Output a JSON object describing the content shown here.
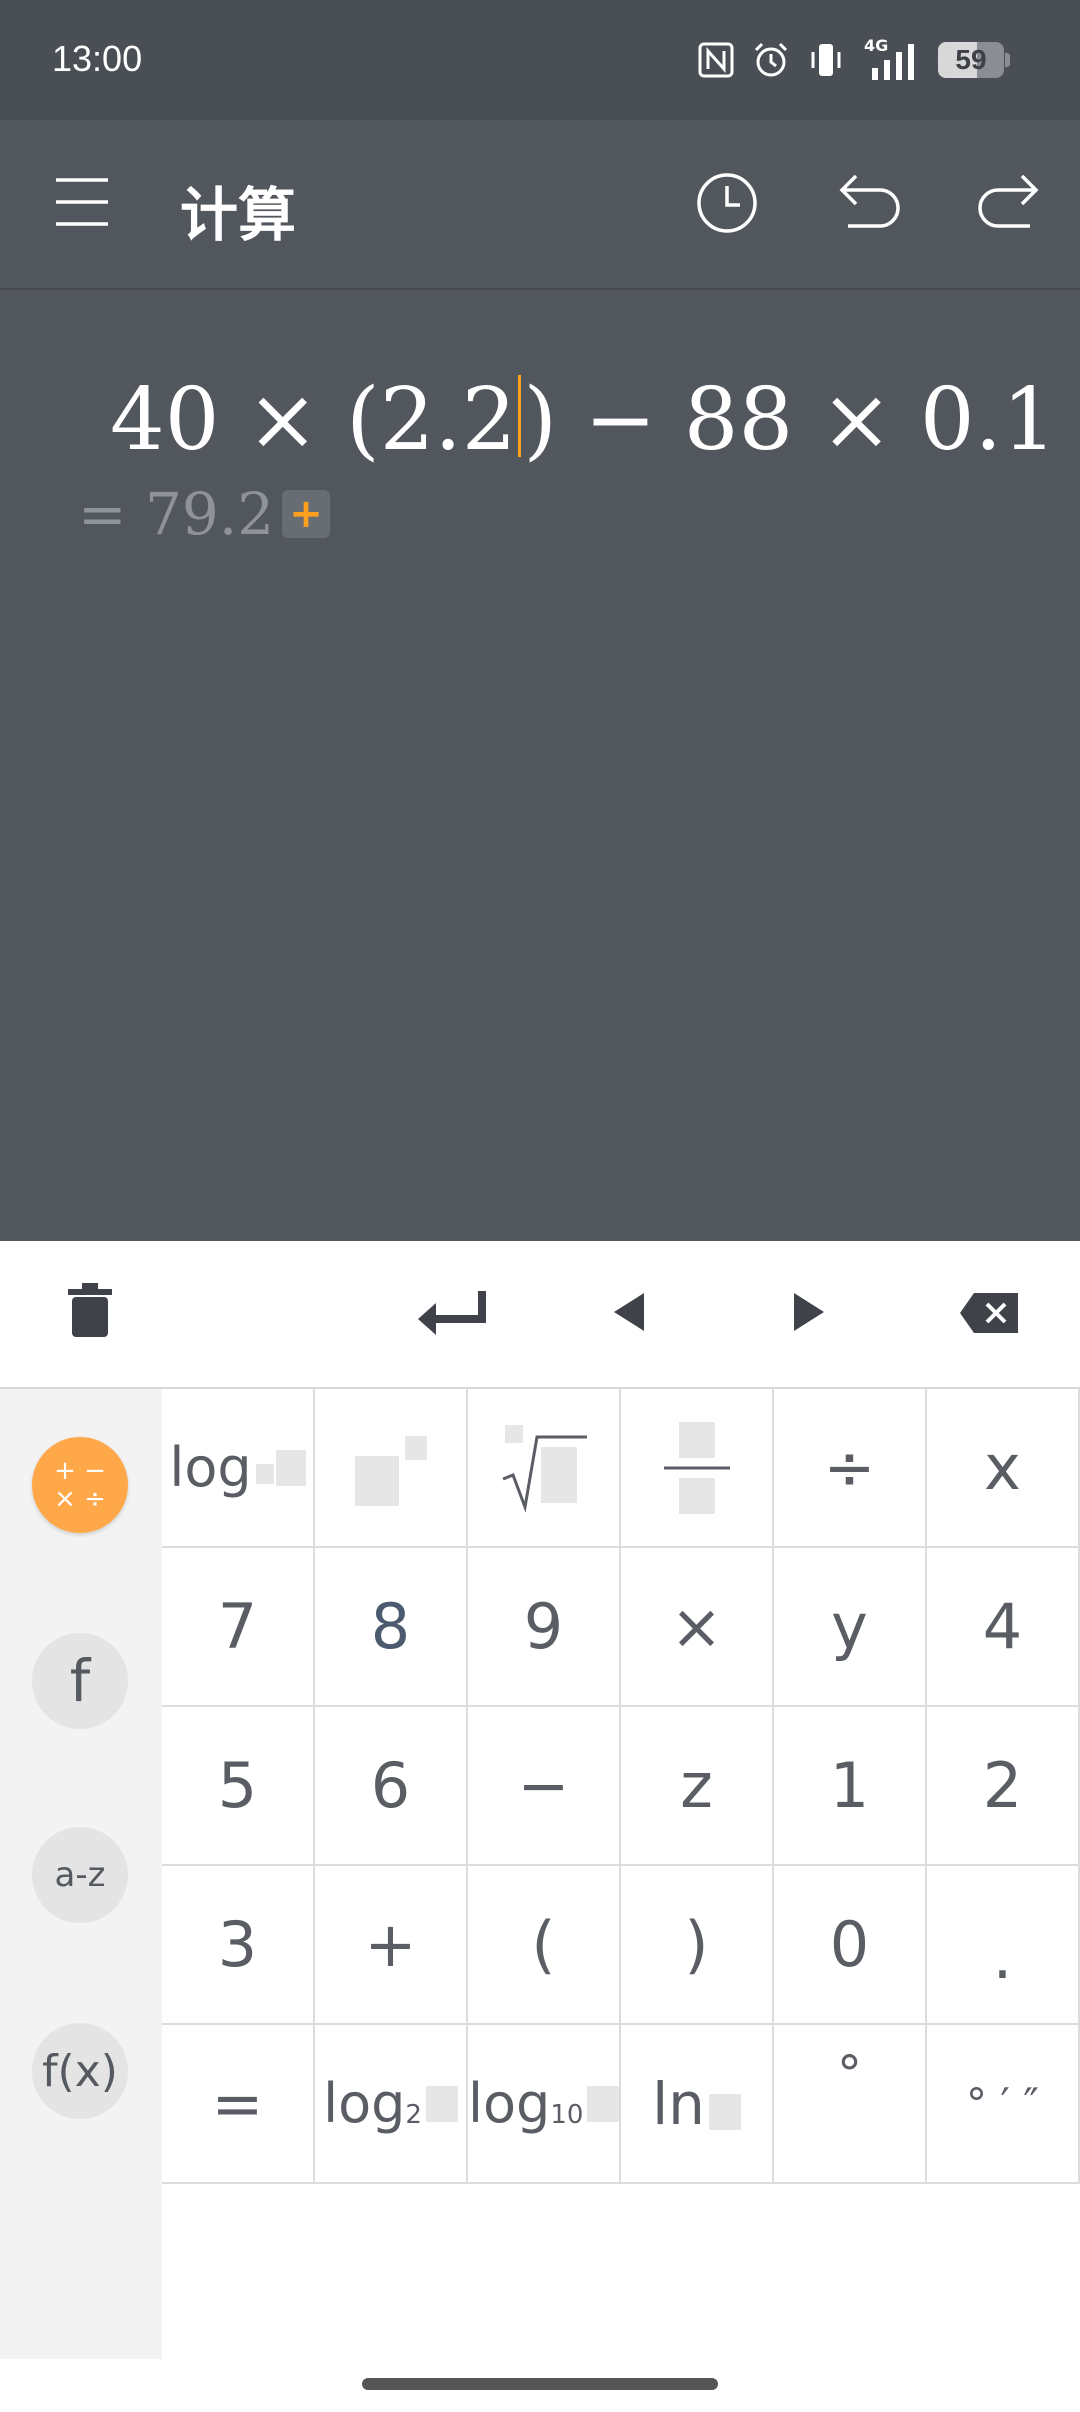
{
  "status_bar": {
    "time": "13:00",
    "battery_level": "59",
    "network": "4G",
    "icons": [
      "nfc-icon",
      "alarm-icon",
      "vibrate-icon",
      "signal-icon",
      "battery-icon"
    ]
  },
  "app_bar": {
    "title": "计算",
    "icons": [
      "menu-icon",
      "history-icon",
      "undo-icon",
      "redo-icon"
    ]
  },
  "display": {
    "expression_before_caret": "40 × (2.2",
    "expression_after_caret": ") − 88 × 0.1",
    "result": "= 79.2",
    "add_label": "+"
  },
  "toolbar": {
    "icons": [
      "trash-icon",
      "enter-icon",
      "cursor-left-icon",
      "cursor-right-icon",
      "backspace-icon"
    ]
  },
  "sidebar": {
    "modes": [
      {
        "label": "+ − × ÷",
        "active": true
      },
      {
        "label": "f",
        "active": false
      },
      {
        "label": "a-z",
        "active": false
      },
      {
        "label": "f(x)",
        "active": false
      }
    ]
  },
  "keypad": {
    "row1": [
      "log",
      "",
      "",
      "",
      "÷"
    ],
    "row2": [
      "x",
      "7",
      "8",
      "9",
      "×"
    ],
    "row3": [
      "y",
      "4",
      "5",
      "6",
      "−"
    ],
    "row4": [
      "z",
      "1",
      "2",
      "3",
      "+"
    ],
    "row5": [
      "(",
      ")",
      "0",
      ".",
      "="
    ],
    "row6": [
      "log",
      "2",
      "log",
      "10",
      "ln",
      "°",
      "° ′ ″"
    ]
  },
  "colors": {
    "accent": "#ffa01e",
    "background": "#52565d",
    "keypad": "#ffffff"
  }
}
